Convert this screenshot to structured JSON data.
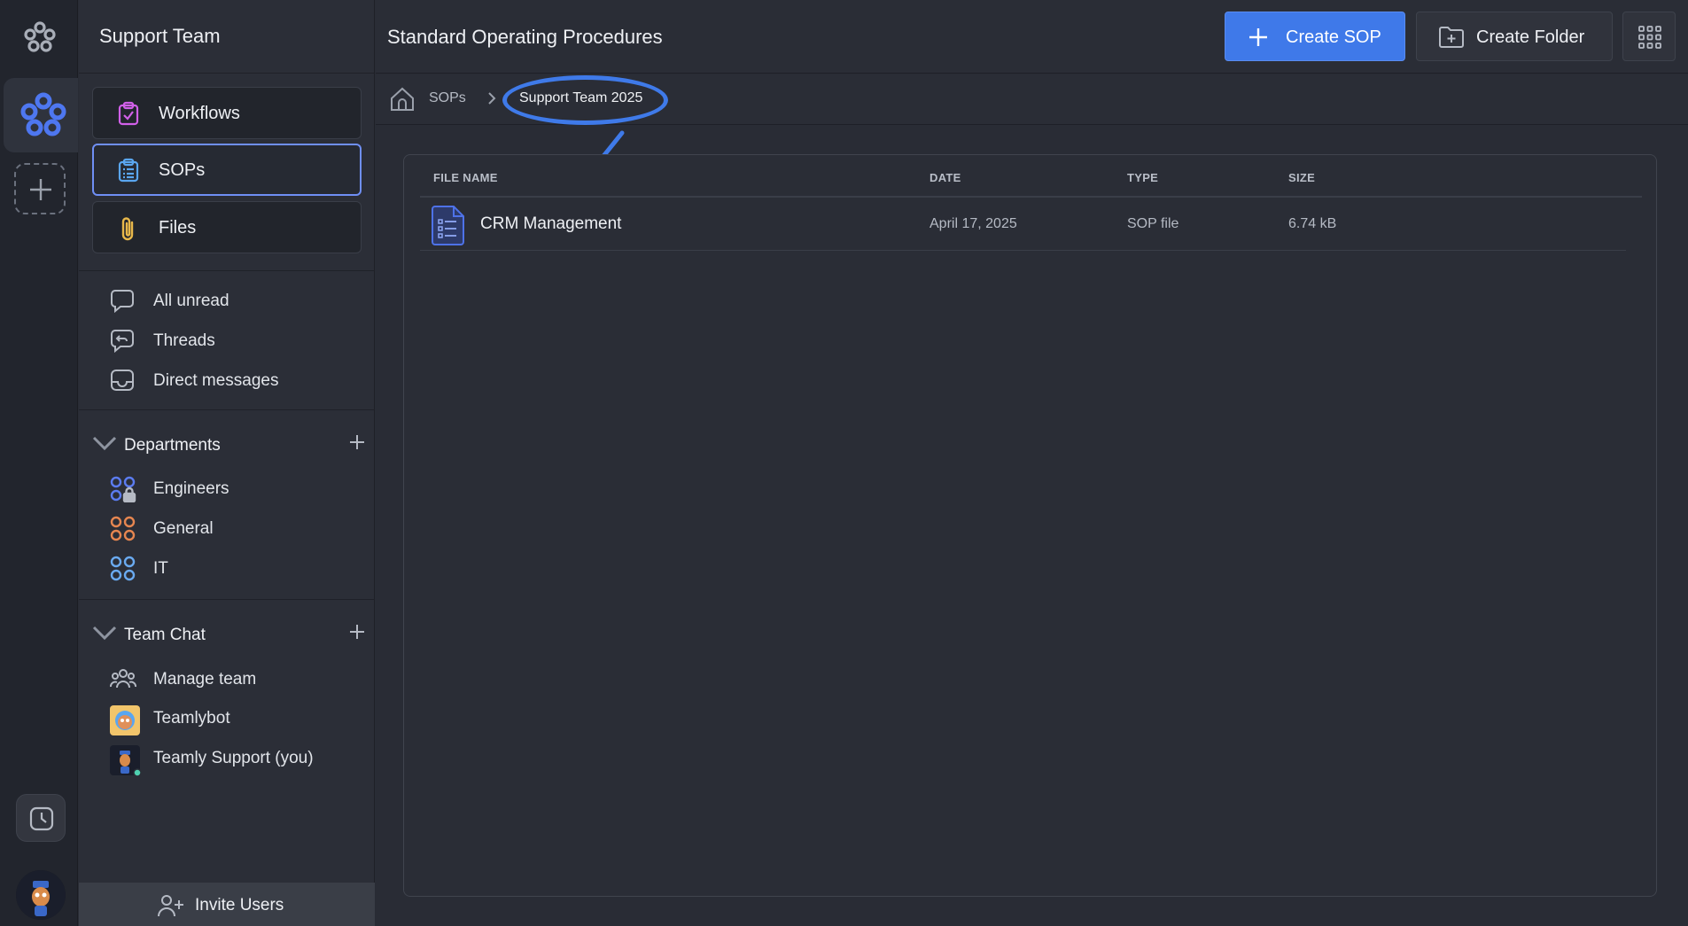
{
  "sidebar": {
    "workspace_title": "Support Team",
    "nav": [
      {
        "label": "Workflows",
        "icon": "clipboard-check-icon",
        "color": "#d160e8"
      },
      {
        "label": "SOPs",
        "icon": "clipboard-list-icon",
        "color": "#5aa6f0",
        "active": true
      },
      {
        "label": "Files",
        "icon": "paperclip-icon",
        "color": "#e8b84a"
      }
    ],
    "quick": [
      {
        "label": "All unread",
        "icon": "chat-bubble-icon"
      },
      {
        "label": "Threads",
        "icon": "threads-icon"
      },
      {
        "label": "Direct messages",
        "icon": "inbox-icon"
      }
    ],
    "departments": {
      "label": "Departments",
      "items": [
        {
          "label": "Engineers",
          "icon": "locked-channel-icon",
          "color": "#5b7cf0"
        },
        {
          "label": "General",
          "icon": "channel-icon",
          "color": "#e68650"
        },
        {
          "label": "IT",
          "icon": "channel-icon",
          "color": "#6aaaf0"
        }
      ]
    },
    "team_chat": {
      "label": "Team Chat",
      "items": [
        {
          "label": "Manage team",
          "icon": "people-icon"
        },
        {
          "label": "Teamlybot",
          "icon": "bot-avatar"
        },
        {
          "label": "Teamly Support (you)",
          "icon": "user-avatar"
        }
      ]
    },
    "invite_label": "Invite Users"
  },
  "header": {
    "title": "Standard Operating Procedures",
    "create_sop": "Create SOP",
    "create_folder": "Create Folder"
  },
  "breadcrumb": {
    "root": "SOPs",
    "current": "Support Team 2025",
    "highlight_color": "#3f7ae9"
  },
  "table": {
    "headers": {
      "name": "FILE NAME",
      "date": "DATE",
      "type": "TYPE",
      "size": "SIZE"
    },
    "rows": [
      {
        "name": "CRM Management",
        "date": "April 17, 2025",
        "type": "SOP file",
        "size": "6.74 kB"
      }
    ]
  },
  "colors": {
    "accent": "#3f79e9",
    "background": "#292c35",
    "sidebar": "#2b2e37",
    "rail": "#22252d"
  }
}
